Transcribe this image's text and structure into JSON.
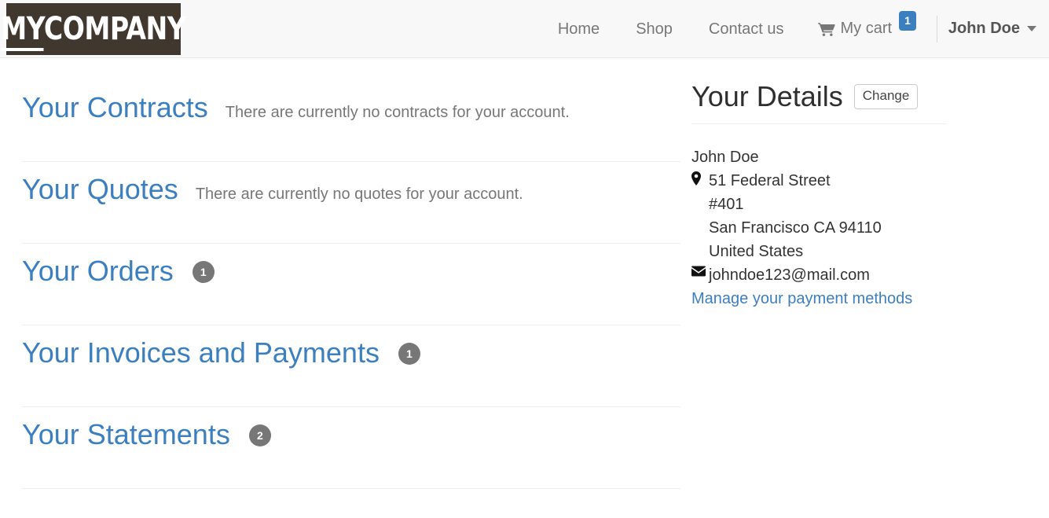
{
  "header": {
    "brand": {
      "prefix": "MY",
      "suffix": "COMPANY"
    },
    "nav": [
      {
        "label": "Home",
        "name": "nav-home"
      },
      {
        "label": "Shop",
        "name": "nav-shop"
      },
      {
        "label": "Contact us",
        "name": "nav-contact-us"
      }
    ],
    "cart": {
      "label": "My cart",
      "count": "1",
      "icon": "shopping-cart-icon"
    },
    "user": {
      "label": "John Doe",
      "icon": "chevron-down-icon"
    }
  },
  "main": {
    "sections": [
      {
        "title": "Your Contracts",
        "note": "There are currently no contracts for your account.",
        "badge": ""
      },
      {
        "title": "Your Quotes",
        "note": "There are currently no quotes for your account.",
        "badge": ""
      },
      {
        "title": "Your Orders",
        "note": "",
        "badge": "1"
      },
      {
        "title": "Your Invoices and Payments",
        "note": "",
        "badge": "1"
      },
      {
        "title": "Your Statements",
        "note": "",
        "badge": "2"
      }
    ]
  },
  "sidebar": {
    "title": "Your Details",
    "change_label": "Change",
    "name": "John Doe",
    "address": {
      "street": "51 Federal Street",
      "unit": "#401",
      "city_state_zip": "San Francisco CA 94110",
      "country": "United States",
      "icon": "map-pin-icon"
    },
    "email": "johndoe123@mail.com",
    "email_icon": "envelope-icon",
    "payment_link": "Manage your payment methods"
  },
  "colors": {
    "link_blue": "#3c7fbf",
    "badge_gray": "#777777",
    "brand_dark": "#40372f",
    "navbar_bg": "#f8f8f8",
    "divider": "#eeeeee"
  }
}
